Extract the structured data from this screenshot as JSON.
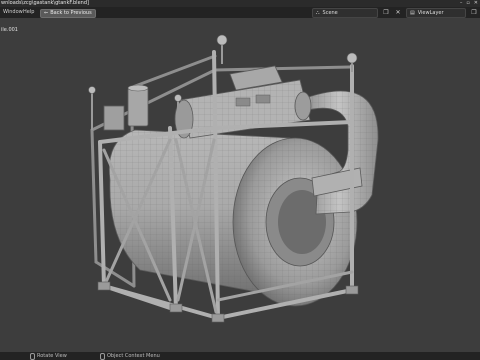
{
  "titlebar": {
    "title": "wnloads\\zcg\\gastank\\gtankF.blend]",
    "icons": [
      "minimize-icon",
      "maximize-icon",
      "close-icon"
    ]
  },
  "menubar": {
    "items": [
      "Window",
      "Help"
    ],
    "back_button": "Back to Previous",
    "scene_label": "Scene",
    "layer_label": "ViewLayer"
  },
  "viewport": {
    "object_label": "ile.001",
    "background_color": "#3d3d3d",
    "model_color": "#a5a5a5"
  },
  "statusbar": {
    "hints": [
      "Rotate View",
      "Object Context Menu"
    ]
  }
}
